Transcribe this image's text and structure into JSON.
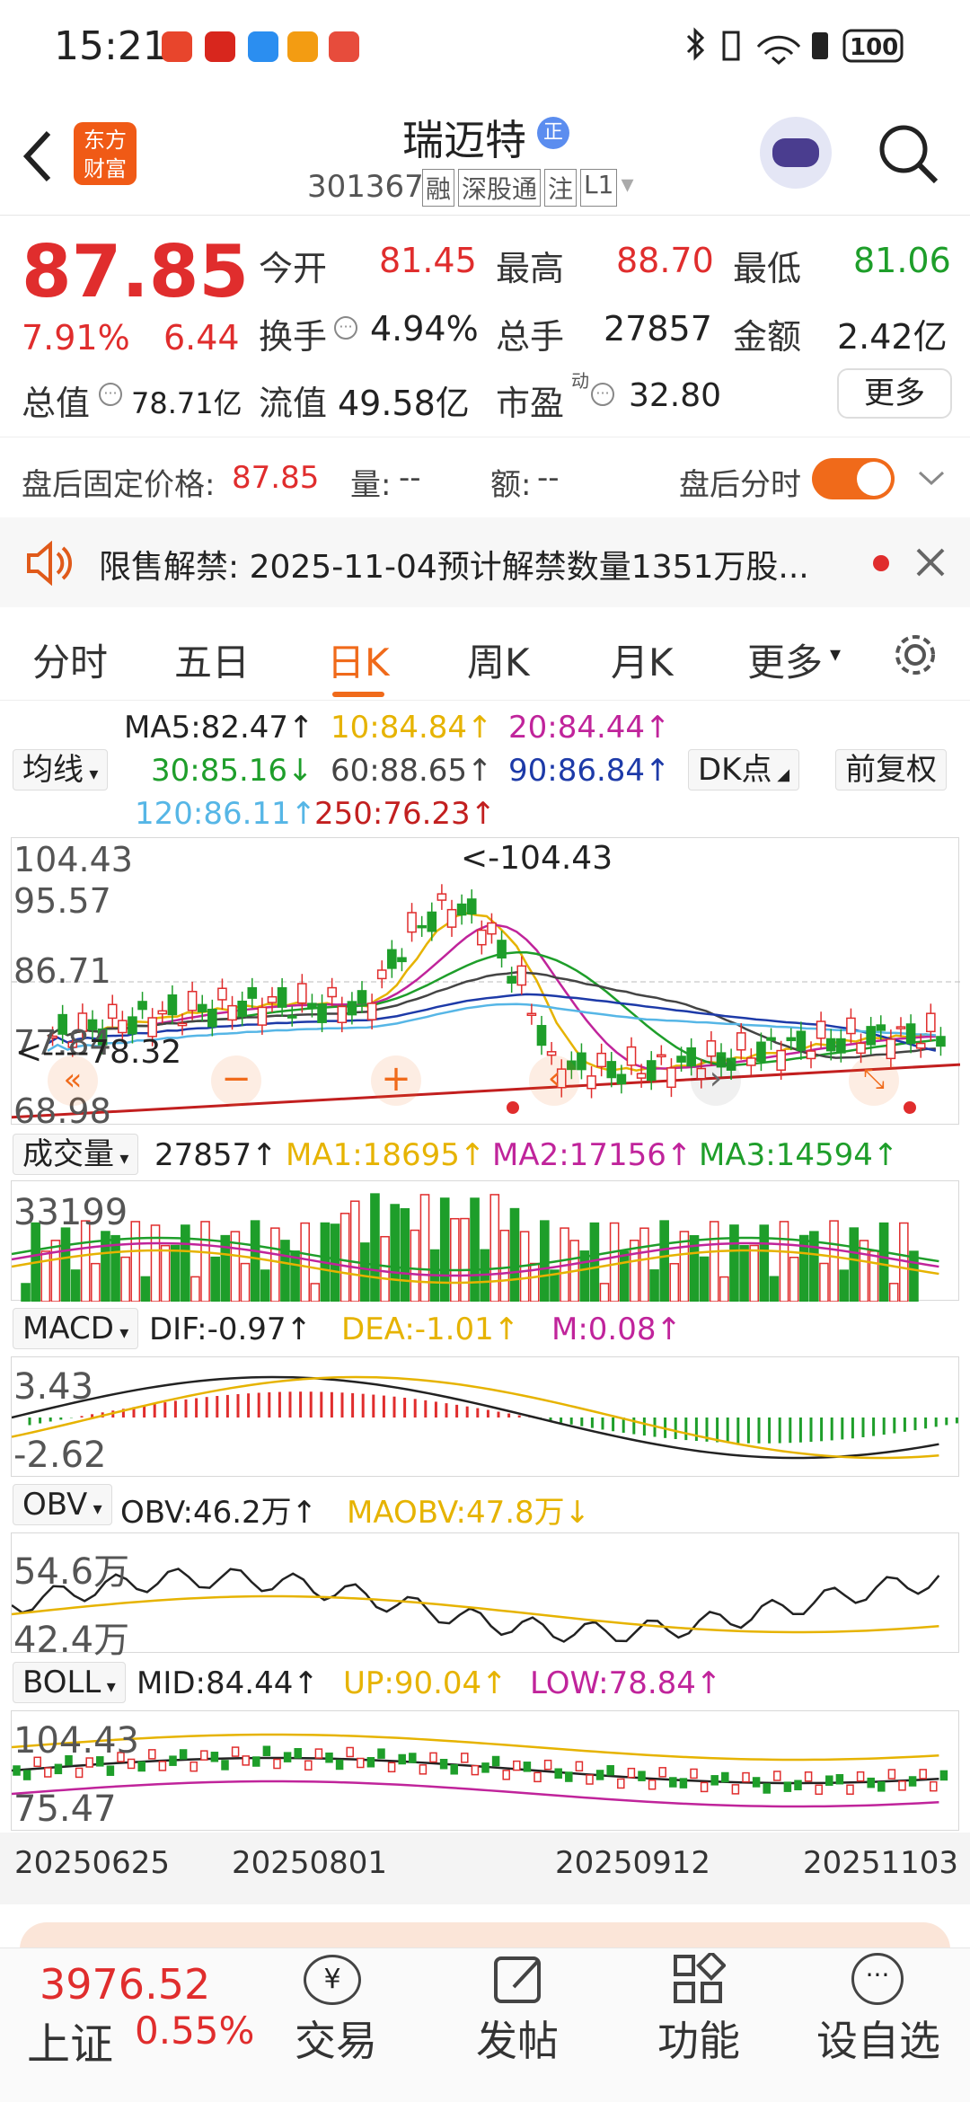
{
  "status": {
    "time": "15:21",
    "battery": "100"
  },
  "header": {
    "title": "瑞迈特",
    "code": "301367",
    "tags": [
      "融",
      "深股通",
      "注",
      "L1"
    ],
    "logo_text": "东方财富",
    "badge": "正"
  },
  "quote": {
    "price": "87.85",
    "pct": "7.91%",
    "change": "6.44",
    "jk_label": "今开",
    "jk_val": "81.45",
    "zg_label": "最高",
    "zg_val": "88.70",
    "zd_label": "最低",
    "zd_val": "81.06",
    "hs_label": "换手",
    "hs_val": "4.94%",
    "zs_label": "总手",
    "zs_val": "27857",
    "je_label": "金额",
    "je_val": "2.42亿",
    "zz_label": "总值",
    "zz_val": "78.71亿",
    "lt_label": "流值",
    "lt_val": "49.58亿",
    "sy_label": "市盈",
    "sy_sup": "动",
    "sy_val": "32.80",
    "more": "更多"
  },
  "after": {
    "label": "盘后固定价格:",
    "price": "87.85",
    "vol_label": "量:",
    "vol": "--",
    "amt_label": "额:",
    "amt": "--",
    "tfs": "盘后分时"
  },
  "notice": {
    "text": "限售解禁:  2025-11-04预计解禁数量1351万股..."
  },
  "tabs": [
    "分时",
    "五日",
    "日K",
    "周K",
    "月K",
    "更多"
  ],
  "ma": {
    "select": "均线",
    "ma5": "MA5:82.47↑",
    "ma10": "10:84.84↑",
    "ma20": "20:84.44↑",
    "ma30": "30:85.16↓",
    "ma60": "60:88.65↑",
    "ma90": "90:86.84↑",
    "ma120": "120:86.11↑",
    "ma250": "250:76.23↑",
    "dk": "DK点",
    "fq": "前复权"
  },
  "kchart": {
    "ymax": "104.43",
    "y2": "95.57",
    "y3": "86.71",
    "y4": "77.84",
    "ymin": "68.98",
    "high_note": "<-104.43",
    "low_note": "<----78.32"
  },
  "vol": {
    "select": "成交量",
    "v": "27857↑",
    "ma1": "MA1:18695↑",
    "ma2": "MA2:17156↑",
    "ma3": "MA3:14594↑",
    "ymax": "33199"
  },
  "macd": {
    "select": "MACD",
    "dif": "DIF:-0.97↑",
    "dea": "DEA:-1.01↑",
    "m": "M:0.08↑",
    "ymax": "3.43",
    "ymin": "-2.62"
  },
  "obv": {
    "select": "OBV",
    "obv": "OBV:46.2万↑",
    "maobv": "MAOBV:47.8万↓",
    "ymax": "54.6万",
    "ymin": "42.4万"
  },
  "boll": {
    "select": "BOLL",
    "mid": "MID:84.44↑",
    "up": "UP:90.04↑",
    "low": "LOW:78.84↑",
    "ymax": "104.43",
    "ymin": "75.47"
  },
  "dates": [
    "20250625",
    "20250801",
    "20250912",
    "20251103"
  ],
  "bottom": {
    "index_val": "3976.52",
    "index_name": "上证",
    "index_pct": "0.55%",
    "nav": [
      "交易",
      "发帖",
      "功能",
      "设自选"
    ]
  },
  "colors": {
    "up": "#e02d2d",
    "down": "#1e9e2a",
    "accent": "#f06a1a"
  }
}
